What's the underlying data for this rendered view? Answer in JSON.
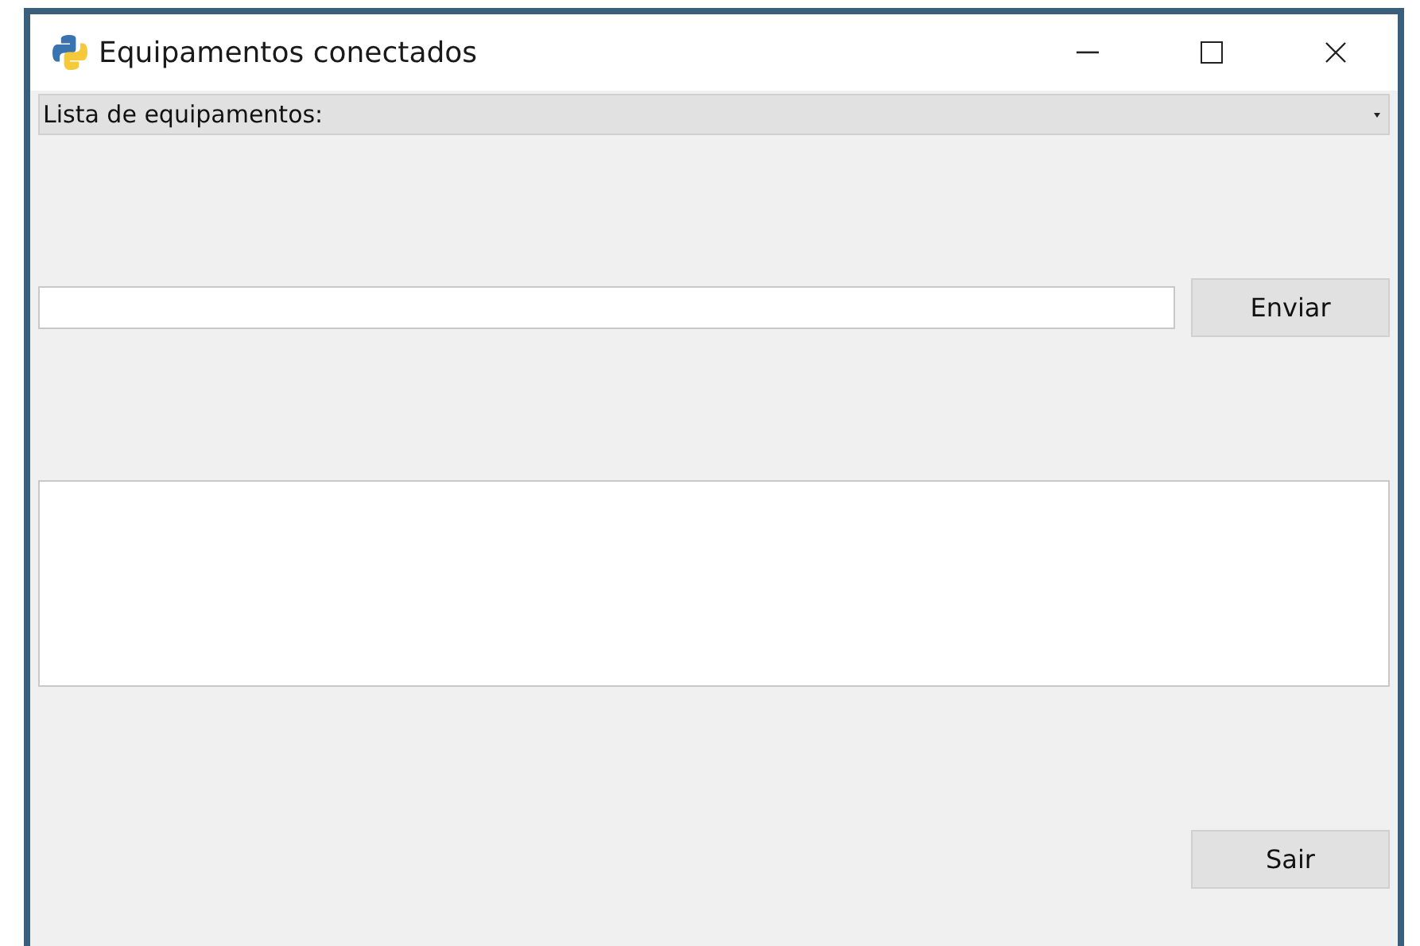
{
  "window": {
    "title": "Equipamentos conectados"
  },
  "device_list": {
    "value": "Lista de equipamentos:"
  },
  "buttons": [
    {
      "label": "Enviar"
    },
    {
      "label": "Sair"
    }
  ]
}
